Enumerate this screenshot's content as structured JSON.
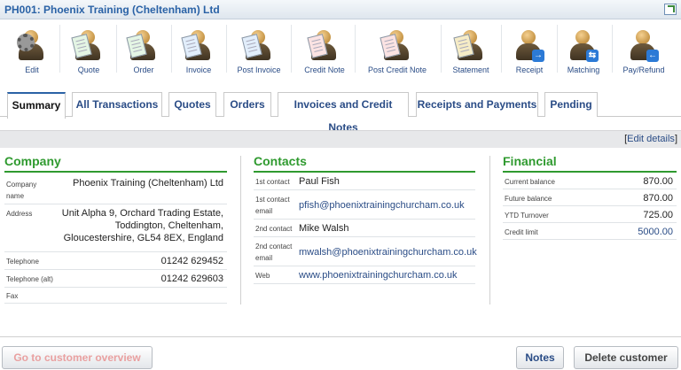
{
  "window": {
    "title": "PH001: Phoenix Training (Cheltenham) Ltd"
  },
  "toolbar": {
    "items": [
      {
        "label": "Edit",
        "icon": "edit-gear-icon"
      },
      {
        "label": "Quote",
        "icon": "quote-icon"
      },
      {
        "label": "Order",
        "icon": "order-icon"
      },
      {
        "label": "Invoice",
        "icon": "invoice-icon"
      },
      {
        "label": "Post Invoice",
        "icon": "post-invoice-icon"
      },
      {
        "label": "Credit Note",
        "icon": "credit-note-icon"
      },
      {
        "label": "Post Credit Note",
        "icon": "post-credit-note-icon"
      },
      {
        "label": "Statement",
        "icon": "statement-icon"
      },
      {
        "label": "Receipt",
        "icon": "receipt-icon"
      },
      {
        "label": "Matching",
        "icon": "matching-icon"
      },
      {
        "label": "Pay/Refund",
        "icon": "pay-refund-icon"
      }
    ]
  },
  "tabs": [
    "Summary",
    "All Transactions",
    "Quotes",
    "Orders",
    "Invoices and Credit Notes",
    "Receipts and Payments",
    "Pending"
  ],
  "edit_details": {
    "open": "[",
    "link": "Edit details",
    "close": "]"
  },
  "company": {
    "heading": "Company",
    "rows": [
      {
        "label": "Company name",
        "value": "Phoenix Training (Cheltenham) Ltd"
      },
      {
        "label": "Address",
        "value": "Unit Alpha 9, Orchard Trading Estate, Toddington, Cheltenham, Gloucestershire, GL54 8EX, England"
      },
      {
        "label": "Telephone",
        "value": "01242 629452"
      },
      {
        "label": "Telephone (alt)",
        "value": "01242 629603"
      },
      {
        "label": "Fax",
        "value": ""
      }
    ]
  },
  "contacts": {
    "heading": "Contacts",
    "rows": [
      {
        "label": "1st contact",
        "value": "Paul Fish"
      },
      {
        "label": "1st contact email",
        "value": "pfish@phoenixtrainingchurcham.co.uk"
      },
      {
        "label": "2nd contact",
        "value": "Mike Walsh"
      },
      {
        "label": "2nd contact email",
        "value": "mwalsh@phoenixtrainingchurcham.co.uk"
      },
      {
        "label": "Web",
        "value": "www.phoenixtrainingchurcham.co.uk"
      }
    ]
  },
  "financial": {
    "heading": "Financial",
    "rows": [
      {
        "label": "Current balance",
        "value": "870.00"
      },
      {
        "label": "Future balance",
        "value": "870.00"
      },
      {
        "label": "YTD Turnover",
        "value": "725.00"
      },
      {
        "label": "Credit limit",
        "value": "5000.00"
      }
    ]
  },
  "footer": {
    "overview": "Go to customer overview",
    "notes": "Notes",
    "delete": "Delete customer"
  },
  "colors": {
    "accent_blue": "#2a62a6",
    "section_green": "#2f9a2f",
    "link_blue": "#2a4c86"
  }
}
